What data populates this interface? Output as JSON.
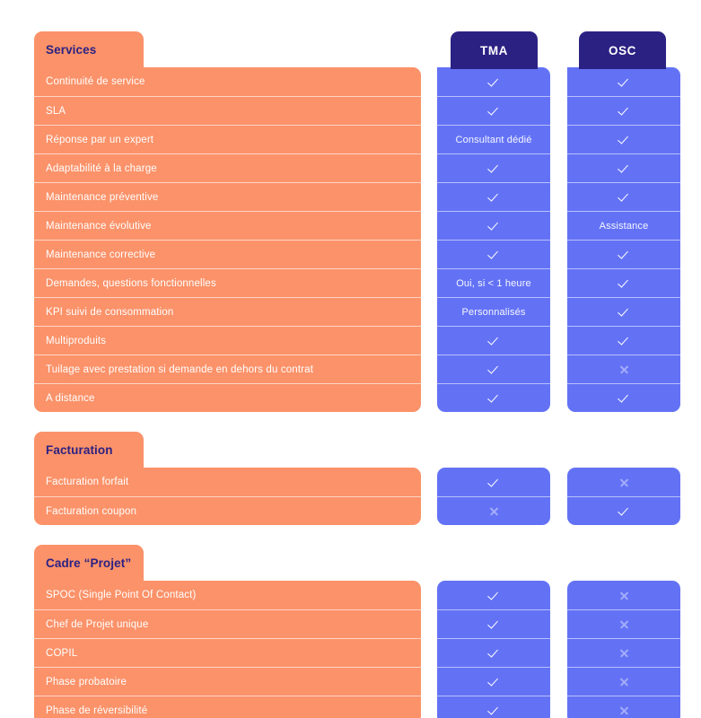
{
  "theme": {
    "page_background": "#ffffff",
    "label_color": "#FB9269",
    "value_color": "#6372F5",
    "header_color": "#2B2183",
    "check_color": "#ffffff",
    "cross_color": "rgba(255,255,255,0.42)"
  },
  "columns": [
    {
      "key": "tma",
      "label": "TMA"
    },
    {
      "key": "osc",
      "label": "OSC"
    }
  ],
  "sections": [
    {
      "title": "Services",
      "rows": [
        {
          "label": "Continuité de service",
          "tma": "check",
          "osc": "check"
        },
        {
          "label": "SLA",
          "tma": "check",
          "osc": "check"
        },
        {
          "label": "Réponse par un expert",
          "tma": "Consultant dédié",
          "osc": "check"
        },
        {
          "label": "Adaptabilité à la charge",
          "tma": "check",
          "osc": "check"
        },
        {
          "label": "Maintenance préventive",
          "tma": "check",
          "osc": "check"
        },
        {
          "label": "Maintenance évolutive",
          "tma": "check",
          "osc": "Assistance"
        },
        {
          "label": "Maintenance corrective",
          "tma": "check",
          "osc": "check"
        },
        {
          "label": "Demandes, questions fonctionnelles",
          "tma": "Oui, si < 1 heure",
          "osc": "check"
        },
        {
          "label": "KPI suivi de consommation",
          "tma": "Personnalisés",
          "osc": "check"
        },
        {
          "label": "Multiproduits",
          "tma": "check",
          "osc": "check"
        },
        {
          "label": "Tuilage avec prestation si demande en dehors du contrat",
          "tma": "check",
          "osc": "cross"
        },
        {
          "label": "A distance",
          "tma": "check",
          "osc": "check"
        }
      ]
    },
    {
      "title": "Facturation",
      "rows": [
        {
          "label": "Facturation forfait",
          "tma": "check",
          "osc": "cross"
        },
        {
          "label": "Facturation coupon",
          "tma": "cross",
          "osc": "check"
        }
      ]
    },
    {
      "title": "Cadre “Projet”",
      "rows": [
        {
          "label": "SPOC (Single Point Of Contact)",
          "tma": "check",
          "osc": "cross"
        },
        {
          "label": "Chef de Projet unique",
          "tma": "check",
          "osc": "cross"
        },
        {
          "label": "COPIL",
          "tma": "check",
          "osc": "cross"
        },
        {
          "label": "Phase probatoire",
          "tma": "check",
          "osc": "cross"
        },
        {
          "label": "Phase de réversibilité",
          "tma": "check",
          "osc": "cross"
        }
      ]
    }
  ]
}
